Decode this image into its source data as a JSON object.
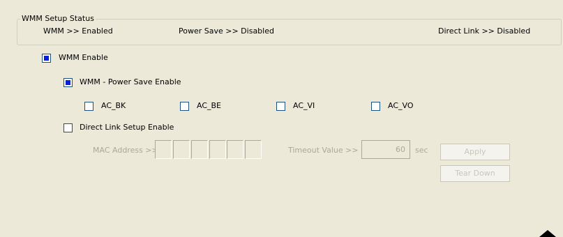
{
  "status": {
    "group_title": "WMM Setup Status",
    "wmm": "WMM >> Enabled",
    "power_save": "Power Save >> Disabled",
    "direct_link": "Direct Link >> Disabled"
  },
  "wmm_enable": {
    "label": "WMM Enable",
    "checked": true
  },
  "power_save_enable": {
    "label": "WMM - Power Save Enable",
    "checked": true
  },
  "ac_options": [
    {
      "label": "AC_BK",
      "checked": false
    },
    {
      "label": "AC_BE",
      "checked": false
    },
    {
      "label": "AC_VI",
      "checked": false
    },
    {
      "label": "AC_VO",
      "checked": false
    }
  ],
  "direct_link_setup": {
    "label": "Direct Link Setup Enable",
    "checked": false
  },
  "mac_address": {
    "label": "MAC Address >>",
    "fields": [
      "",
      "",
      "",
      "",
      "",
      ""
    ]
  },
  "timeout": {
    "label": "Timeout Value >>",
    "value": "60",
    "unit": "sec"
  },
  "buttons": {
    "apply": "Apply",
    "tear_down": "Tear Down"
  },
  "icons": {
    "scroll": "scroll-up-arrow-icon"
  }
}
